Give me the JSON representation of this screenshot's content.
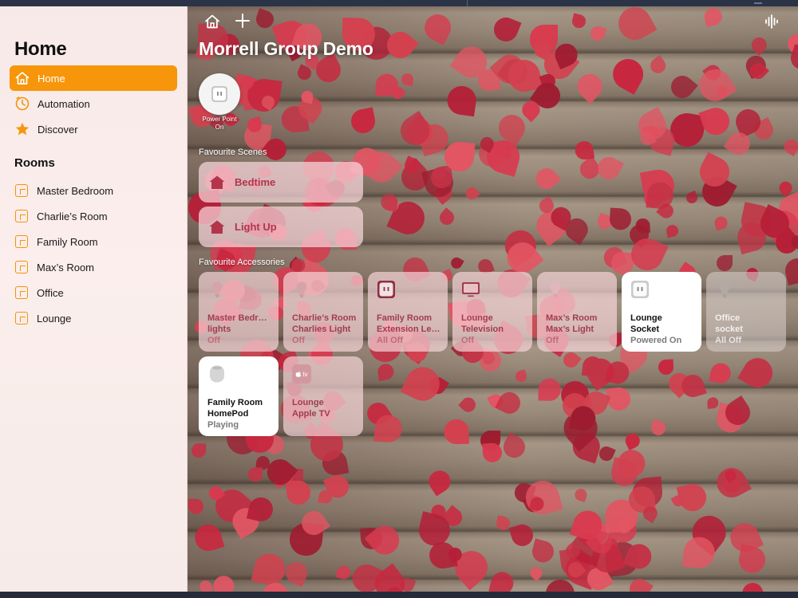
{
  "sidebar": {
    "title": "Home",
    "nav": [
      {
        "label": "Home",
        "icon": "house-icon",
        "active": true
      },
      {
        "label": "Automation",
        "icon": "clock-icon",
        "active": false
      },
      {
        "label": "Discover",
        "icon": "star-icon",
        "active": false
      }
    ],
    "rooms_title": "Rooms",
    "rooms": [
      {
        "label": "Master Bedroom"
      },
      {
        "label": "Charlie’s Room"
      },
      {
        "label": "Family Room"
      },
      {
        "label": "Max’s Room"
      },
      {
        "label": "Office"
      },
      {
        "label": "Lounge"
      }
    ]
  },
  "main": {
    "home_name": "Morrell Group Demo",
    "status": {
      "line1": "Power Point",
      "line2": "On",
      "icon": "outlet-icon"
    },
    "scenes_label": "Favourite Scenes",
    "scenes": [
      {
        "label": "Bedtime",
        "icon": "house-scene-icon"
      },
      {
        "label": "Light Up",
        "icon": "house-scene-icon"
      }
    ],
    "accessories_label": "Favourite Accessories",
    "accessories": [
      {
        "line1": "Master Bedr…",
        "line2": "lights",
        "state": "Off",
        "icon": "bulb-icon"
      },
      {
        "line1": "Charlie’s Room",
        "line2": "Charlies Light",
        "state": "Off",
        "icon": "bulb-icon"
      },
      {
        "line1": "Family Room",
        "line2": "Extension Le…",
        "state": "All Off",
        "icon": "outlet-icon"
      },
      {
        "line1": "Lounge",
        "line2": "Television",
        "state": "Off",
        "icon": "tv-icon"
      },
      {
        "line1": "Max’s Room",
        "line2": "Max’s Light",
        "state": "Off",
        "icon": "bulb-icon"
      },
      {
        "line1": "Lounge",
        "line2": "Socket",
        "state": "Powered On",
        "icon": "outlet-icon"
      },
      {
        "line1": "Office",
        "line2": "socket",
        "state": "All Off",
        "icon": "bulb-icon"
      },
      {
        "line1": "Family Room",
        "line2": "HomePod",
        "state": "Playing",
        "icon": "homepod-icon"
      },
      {
        "line1": "Lounge",
        "line2": "Apple TV",
        "state": "",
        "icon": "appletv-icon",
        "badge": "tv"
      }
    ]
  },
  "colors": {
    "accent": "#f7960b",
    "tile_text": "#a23c4e",
    "scene_text": "#b3354b"
  }
}
